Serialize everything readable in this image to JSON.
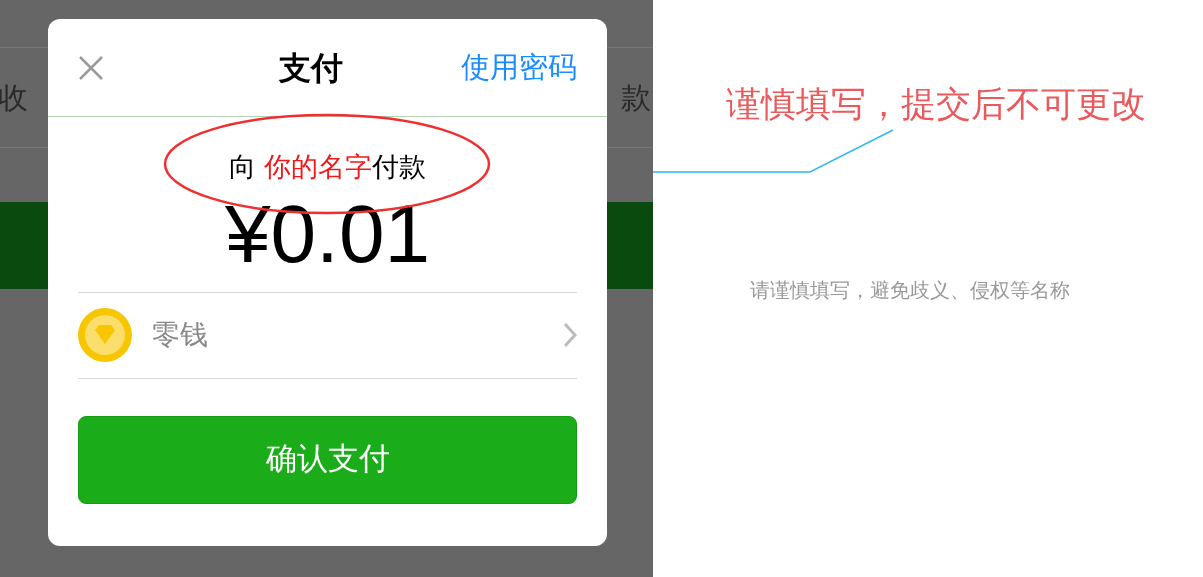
{
  "background": {
    "left_label": "收",
    "right_label": "款"
  },
  "dialog": {
    "title": "支付",
    "alt_action": "使用密码",
    "payee": {
      "prefix": "向 ",
      "name": "你的名字",
      "suffix": "付款"
    },
    "amount": "¥0.01",
    "method": {
      "label": "零钱"
    },
    "confirm": "确认支付"
  },
  "annotation": {
    "callout": "谨慎填写，提交后不可更改",
    "hint": "请谨慎填写，避免歧义、侵权等名称"
  }
}
